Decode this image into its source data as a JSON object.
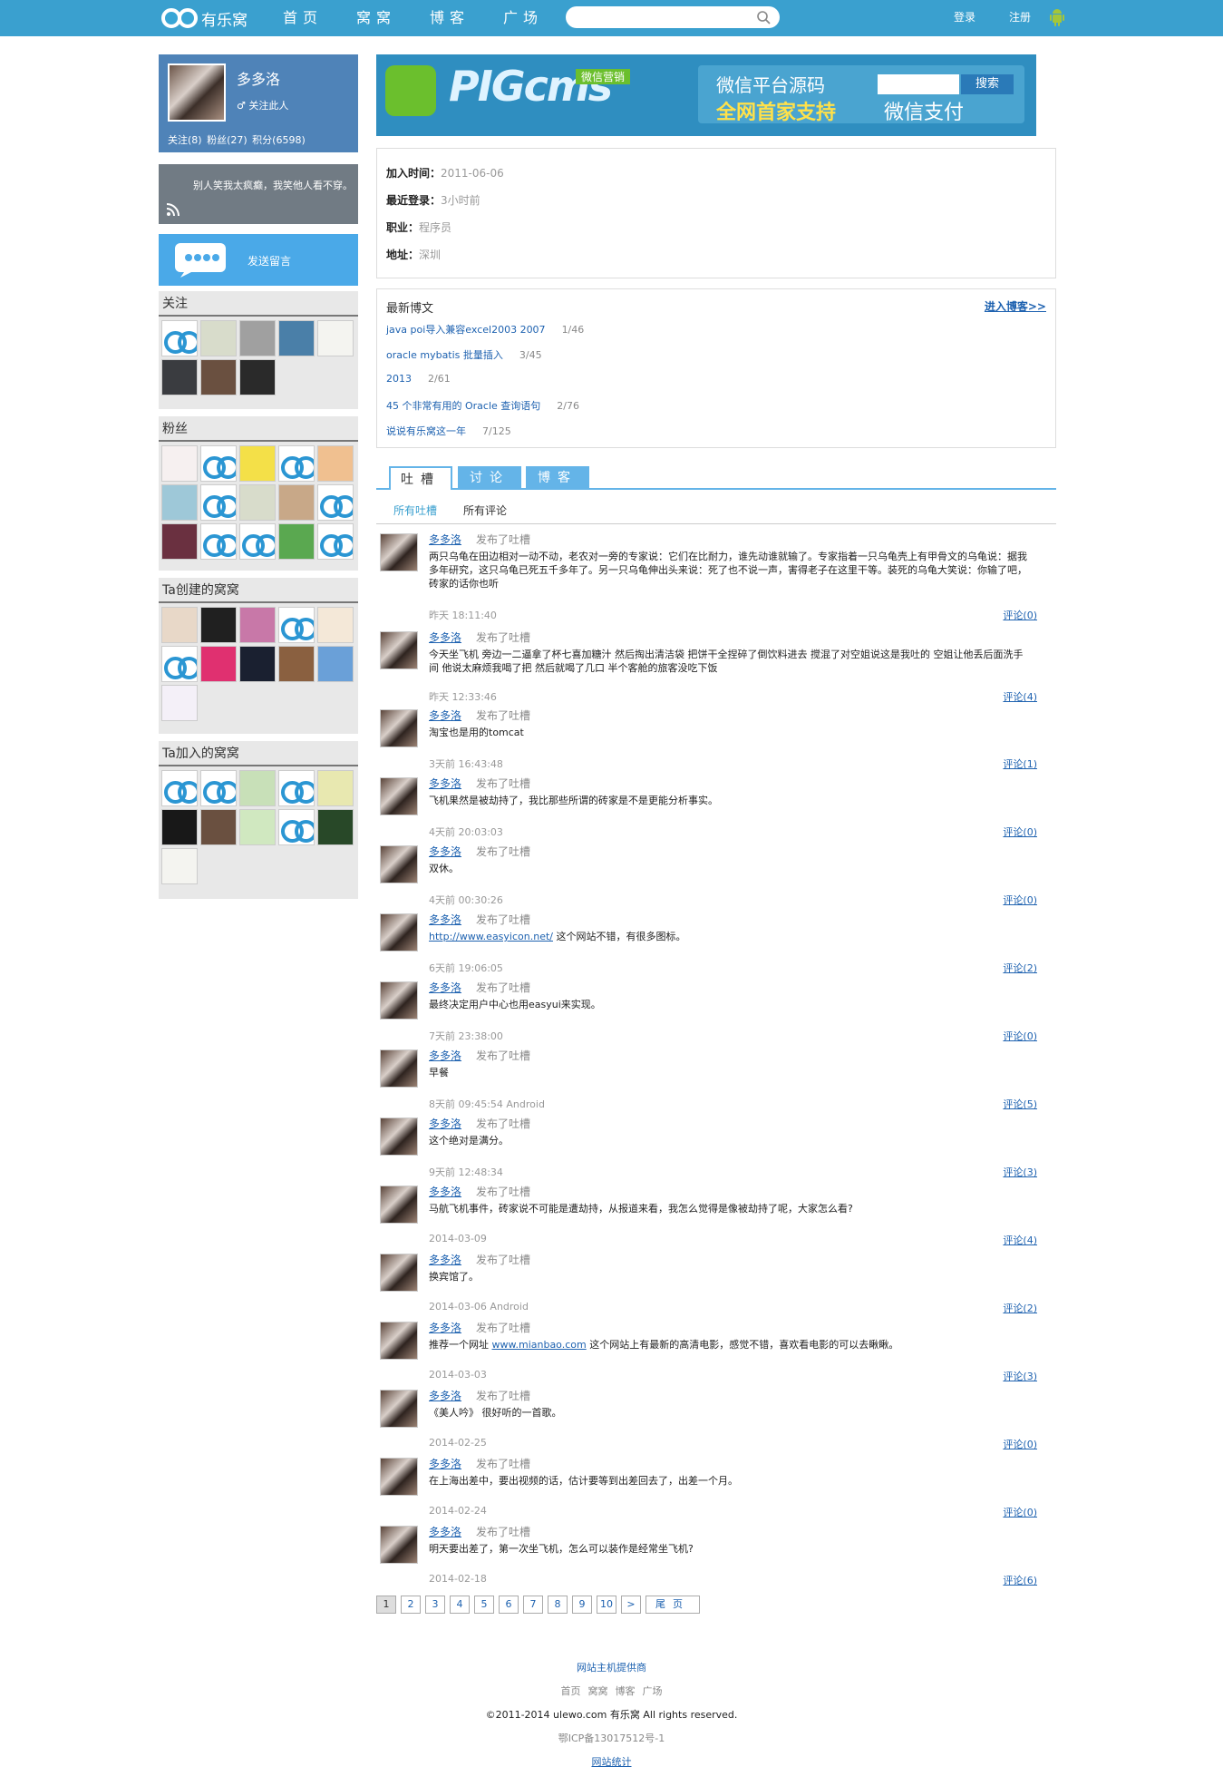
{
  "site": {
    "name": "有乐窝",
    "colors": {
      "topbar": "#3aa0cf",
      "link": "#1e62b0"
    }
  },
  "nav": [
    "首页",
    "窝窝",
    "博客",
    "广场"
  ],
  "search": {
    "placeholder": ""
  },
  "auth": {
    "login": "登录",
    "register": "注册"
  },
  "profile": {
    "name": "多多洛",
    "follow": "♂ 关注此人",
    "stats": "关注(8) 粉丝(27) 积分(6598)",
    "signature": "别人笑我太疯癫，我笑他人看不穿。",
    "message": "发送留言"
  },
  "sections": {
    "following": {
      "title": "关注",
      "count": 8
    },
    "fans": {
      "title": "粉丝",
      "count": 15
    },
    "created": {
      "title": "Ta创建的窝窝",
      "count": 11
    },
    "joined": {
      "title": "Ta加入的窝窝",
      "count": 11
    }
  },
  "banner": {
    "brand": "PIGcms",
    "tag": "微信营销",
    "line1": "微信平台源码",
    "line2": "全网首家支持",
    "line3": "微信支付",
    "button": "搜索"
  },
  "info": [
    {
      "label": "加入时间：",
      "value": "2011-06-06"
    },
    {
      "label": "最近登录：",
      "value": "3小时前"
    },
    {
      "label": "职业：",
      "value": "程序员"
    },
    {
      "label": "地址：",
      "value": "深圳"
    }
  ],
  "latest": {
    "title": "最新博文",
    "link": "进入博客>>",
    "posts": [
      {
        "title": "java poi导入兼容excel2003 2007",
        "stat": "1/46"
      },
      {
        "title": "oracle mybatis 批量插入",
        "stat": "3/45"
      },
      {
        "title": "2013",
        "stat": "2/61"
      },
      {
        "title": "45 个非常有用的 Oracle 查询语句",
        "stat": "2/76"
      },
      {
        "title": "说说有乐窝这一年",
        "stat": "7/125"
      }
    ]
  },
  "tabs": [
    "吐槽",
    "讨论",
    "博客"
  ],
  "subtabs": [
    "所有吐槽",
    "所有评论"
  ],
  "feed": [
    {
      "author": "多多洛",
      "action": "发布了吐槽",
      "text": "两只乌龟在田边相对一动不动，老农对一旁的专家说：它们在比耐力，谁先动谁就输了。专家指着一只乌龟壳上有甲骨文的乌龟说：据我多年研究，这只乌龟已死五千多年了。另一只乌龟伸出头来说：死了也不说一声，害得老子在这里干等。装死的乌龟大笑说：你输了吧，砖家的话你也听",
      "time": "昨天 18:11:40",
      "comment": "评论(0)"
    },
    {
      "author": "多多洛",
      "action": "发布了吐槽",
      "text": "今天坐飞机 旁边一二逼拿了杯七喜加糖汁 然后掏出清洁袋 把饼干全捏碎了倒饮料进去 搅混了对空姐说这是我吐的 空姐让他丢后面洗手间 他说太麻烦我喝了把 然后就喝了几口 半个客舱的旅客没吃下饭",
      "time": "昨天 12:33:46",
      "comment": "评论(4)"
    },
    {
      "author": "多多洛",
      "action": "发布了吐槽",
      "text": "淘宝也是用的tomcat",
      "time": "3天前 16:43:48",
      "comment": "评论(1)"
    },
    {
      "author": "多多洛",
      "action": "发布了吐槽",
      "text": "飞机果然是被劫持了，我比那些所谓的砖家是不是更能分析事实。",
      "time": "4天前 20:03:03",
      "comment": "评论(0)"
    },
    {
      "author": "多多洛",
      "action": "发布了吐槽",
      "text": "双休。",
      "time": "4天前 00:30:26",
      "comment": "评论(0)"
    },
    {
      "author": "多多洛",
      "action": "发布了吐槽",
      "link": "http://www.easyicon.net/",
      "text": " 这个网站不错，有很多图标。",
      "time": "6天前 19:06:05",
      "comment": "评论(2)"
    },
    {
      "author": "多多洛",
      "action": "发布了吐槽",
      "text": "最终决定用户中心也用easyui来实现。",
      "time": "7天前 23:38:00",
      "comment": "评论(0)"
    },
    {
      "author": "多多洛",
      "action": "发布了吐槽",
      "text": "早餐",
      "time": "8天前 09:45:54  Android",
      "comment": "评论(5)"
    },
    {
      "author": "多多洛",
      "action": "发布了吐槽",
      "text": "这个绝对是满分。",
      "time": "9天前 12:48:34",
      "comment": "评论(3)"
    },
    {
      "author": "多多洛",
      "action": "发布了吐槽",
      "text": "马航飞机事件，砖家说不可能是遭劫持，从报道来看，我怎么觉得是像被劫持了呢，大家怎么看?",
      "time": "2014-03-09",
      "comment": "评论(4)"
    },
    {
      "author": "多多洛",
      "action": "发布了吐槽",
      "text": "换宾馆了。",
      "time": "2014-03-06 Android",
      "comment": "评论(2)"
    },
    {
      "author": "多多洛",
      "action": "发布了吐槽",
      "pre": "推荐一个网址 ",
      "link": "www.mianbao.com",
      "text": " 这个网站上有最新的高清电影，感觉不错，喜欢看电影的可以去瞅瞅。",
      "time": "2014-03-03",
      "comment": "评论(3)"
    },
    {
      "author": "多多洛",
      "action": "发布了吐槽",
      "text": "《美人吟》 很好听的一首歌。",
      "time": "2014-02-25",
      "comment": "评论(0)"
    },
    {
      "author": "多多洛",
      "action": "发布了吐槽",
      "text": "在上海出差中，要出视频的话，估计要等到出差回去了，出差一个月。",
      "time": "2014-02-24",
      "comment": "评论(0)"
    },
    {
      "author": "多多洛",
      "action": "发布了吐槽",
      "text": "明天要出差了，第一次坐飞机，怎么可以装作是经常坐飞机?",
      "time": "2014-02-18",
      "comment": "评论(6)"
    }
  ],
  "pager": {
    "pages": [
      "1",
      "2",
      "3",
      "4",
      "5",
      "6",
      "7",
      "8",
      "9",
      "10",
      ">"
    ],
    "last": "尾页",
    "current": "1"
  },
  "footer": {
    "host": "网站主机提供商",
    "links": [
      "首页",
      "窝窝",
      "博客",
      "广场"
    ],
    "copyright": "©2011-2014  ulewo.com 有乐窝  All rights reserved.",
    "icp": "鄂ICP备13017512号-1",
    "stats": "网站统计"
  }
}
